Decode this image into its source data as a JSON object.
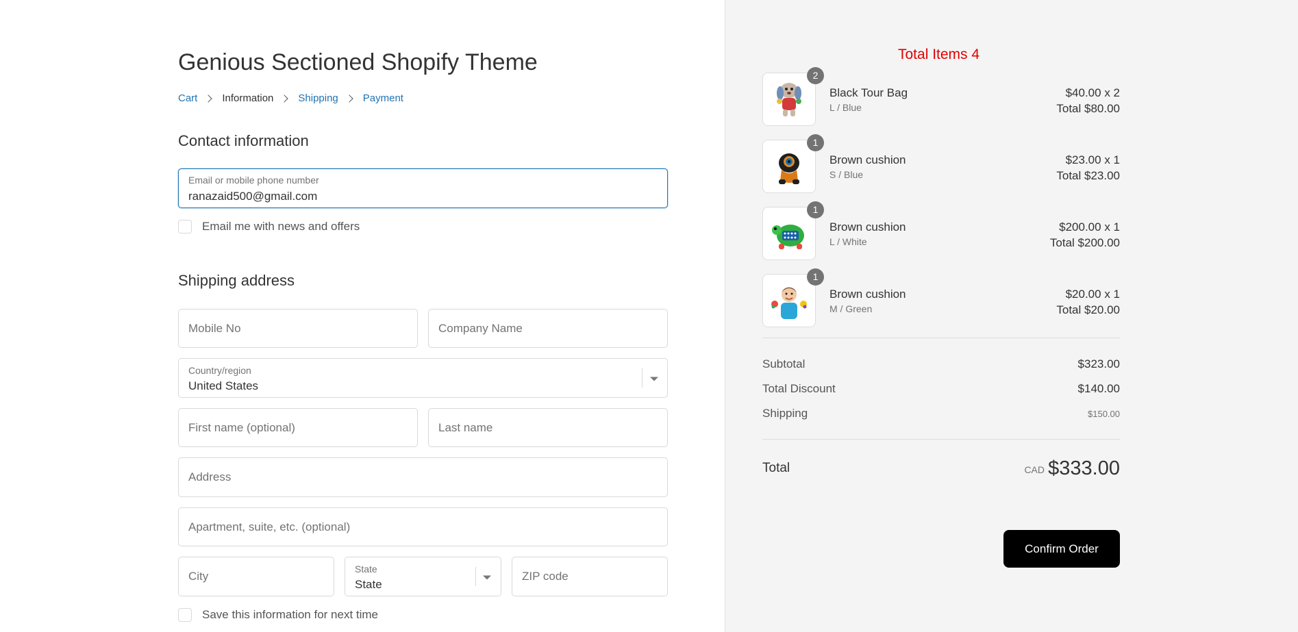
{
  "store": {
    "title": "Genious Sectioned Shopify Theme"
  },
  "breadcrumb": [
    {
      "label": "Cart"
    },
    {
      "label": "Information"
    },
    {
      "label": "Shipping"
    },
    {
      "label": "Payment"
    }
  ],
  "contact": {
    "title": "Contact information",
    "email_label": "Email or mobile phone number",
    "email_value": "ranazaid500@gmail.com",
    "newsletter_label": "Email me with news and offers",
    "newsletter_checked": false
  },
  "shipping": {
    "title": "Shipping address",
    "mobile_placeholder": "Mobile No",
    "company_placeholder": "Company Name",
    "country_label": "Country/region",
    "country_value": "United States",
    "first_name_placeholder": "First name (optional)",
    "last_name_placeholder": "Last name",
    "address_placeholder": "Address",
    "apartment_placeholder": "Apartment, suite, etc. (optional)",
    "city_placeholder": "City",
    "state_label": "State",
    "state_value": "State",
    "zip_placeholder": "ZIP code",
    "save_info_label": "Save this information for next time",
    "save_info_checked": false
  },
  "order": {
    "total_items_label": "Total Items 4",
    "items": [
      {
        "qty_badge": "2",
        "name": "Black Tour Bag",
        "variant": "L / Blue",
        "price_line": "$40.00 x 2",
        "total_line": "Total $80.00",
        "image": "plush-dog-toy-icon"
      },
      {
        "qty_badge": "1",
        "name": "Brown cushion",
        "variant": "S / Blue",
        "price_line": "$23.00 x 1",
        "total_line": "Total $23.00",
        "image": "robot-toy-icon"
      },
      {
        "qty_badge": "1",
        "name": "Brown cushion",
        "variant": "L / White",
        "price_line": "$200.00 x 1",
        "total_line": "Total $200.00",
        "image": "turtle-toy-icon"
      },
      {
        "qty_badge": "1",
        "name": "Brown cushion",
        "variant": "M / Green",
        "price_line": "$20.00 x 1",
        "total_line": "Total $20.00",
        "image": "child-photo-icon"
      }
    ],
    "subtotal_label": "Subtotal",
    "subtotal_value": "$323.00",
    "discount_label": "Total Discount",
    "discount_value": "$140.00",
    "shipping_label": "Shipping",
    "shipping_value": "$150.00",
    "total_label": "Total",
    "currency": "CAD",
    "total_value": "$333.00",
    "confirm_label": "Confirm Order"
  },
  "colors": {
    "link": "#1f74b3",
    "total_items": "#e10000",
    "confirm_button": "#000000",
    "sidebar_bg": "#f4f4f4"
  }
}
